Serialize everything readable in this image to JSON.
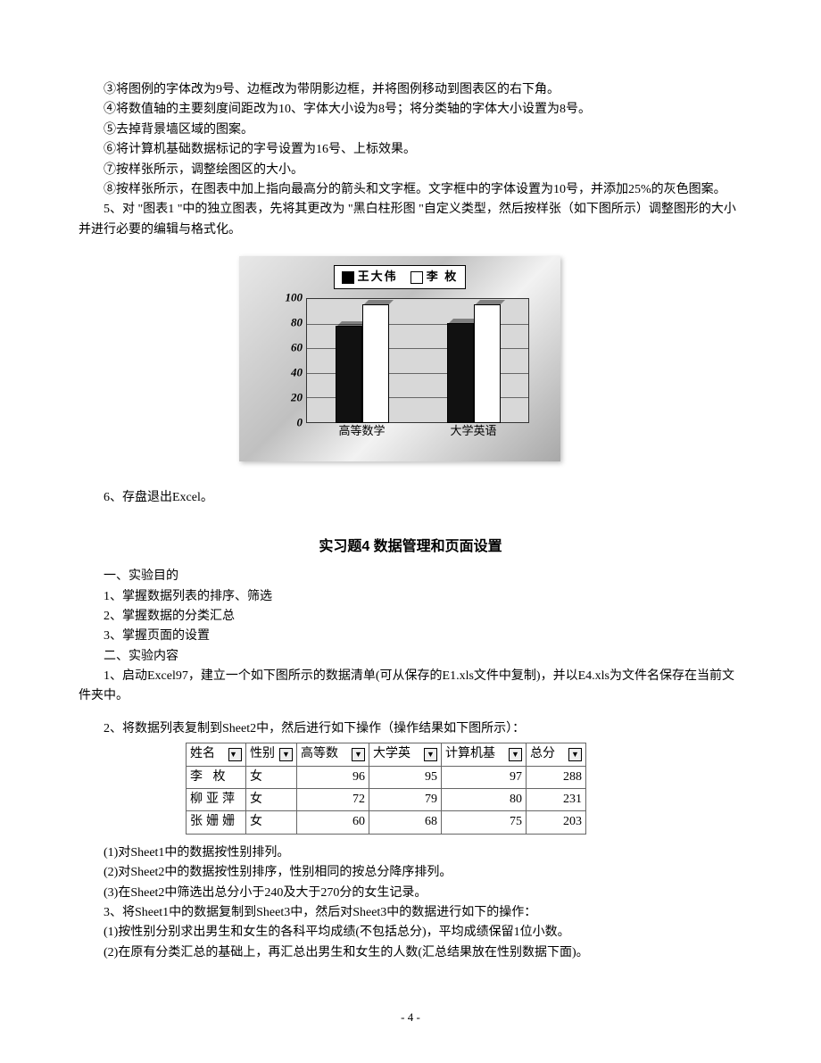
{
  "para": {
    "p3": "③将图例的字体改为9号、边框改为带阴影边框，并将图例移动到图表区的右下角。",
    "p4": "④将数值轴的主要刻度间距改为10、字体大小设为8号；将分类轴的字体大小设置为8号。",
    "p5": "⑤去掉背景墙区域的图案。",
    "p6": "⑥将计算机基础数据标记的字号设置为16号、上标效果。",
    "p7": "⑦按样张所示，调整绘图区的大小。",
    "p8": "⑧按样张所示，在图表中加上指向最高分的箭头和文字框。文字框中的字体设置为10号，并添加25%的灰色图案。",
    "p9": "5、对 \"图表1 \"中的独立图表，先将其更改为 \"黑白柱形图 \"自定义类型，然后按样张（如下图所示）调整图形的大小并进行必要的编辑与格式化。",
    "p10": "6、存盘退出Excel。",
    "title4": "实习题4  数据管理和页面设置",
    "s1": "一、实验目的",
    "s1_1": "1、掌握数据列表的排序、筛选",
    "s1_2": "2、掌握数据的分类汇总",
    "s1_3": "3、掌握页面的设置",
    "s2": "二、实验内容",
    "s2_1": "1、启动Excel97，建立一个如下图所示的数据清单(可从保存的E1.xls文件中复制)，并以E4.xls为文件名保存在当前文件夹中。",
    "s2_2": "2、将数据列表复制到Sheet2中，然后进行如下操作（操作结果如下图所示）：",
    "q1": "(1)对Sheet1中的数据按性别排列。",
    "q2": "(2)对Sheet2中的数据按性别排序，性别相同的按总分降序排列。",
    "q3": "(3)在Sheet2中筛选出总分小于240及大于270分的女生记录。",
    "s2_3": "3、将Sheet1中的数据复制到Sheet3中，然后对Sheet3中的数据进行如下的操作：",
    "q4": "(1)按性别分别求出男生和女生的各科平均成绩(不包括总分)，平均成绩保留1位小数。",
    "q5": "(2)在原有分类汇总的基础上，再汇总出男生和女生的人数(汇总结果放在性别数据下面)。"
  },
  "chart_data": {
    "type": "bar",
    "legend": [
      "王大伟",
      "李 枚"
    ],
    "categories": [
      "高等数学",
      "大学英语"
    ],
    "series": [
      {
        "name": "王大伟",
        "values": [
          78,
          80
        ]
      },
      {
        "name": "李 枚",
        "values": [
          95,
          95
        ]
      }
    ],
    "ylim": [
      0,
      100
    ],
    "yticks": [
      0,
      20,
      40,
      60,
      80,
      100
    ]
  },
  "table": {
    "headers": [
      "姓名",
      "性别",
      "高等数学",
      "大学英语",
      "计算机基础",
      "总分"
    ],
    "rows": [
      {
        "name": "李 枚",
        "gender": "女",
        "math": 96,
        "eng": 95,
        "cs": 97,
        "total": 288
      },
      {
        "name": "柳亚萍",
        "gender": "女",
        "math": 72,
        "eng": 79,
        "cs": 80,
        "total": 231
      },
      {
        "name": "张姗姗",
        "gender": "女",
        "math": 60,
        "eng": 68,
        "cs": 75,
        "total": 203
      }
    ]
  },
  "pageNumber": "- 4 -"
}
